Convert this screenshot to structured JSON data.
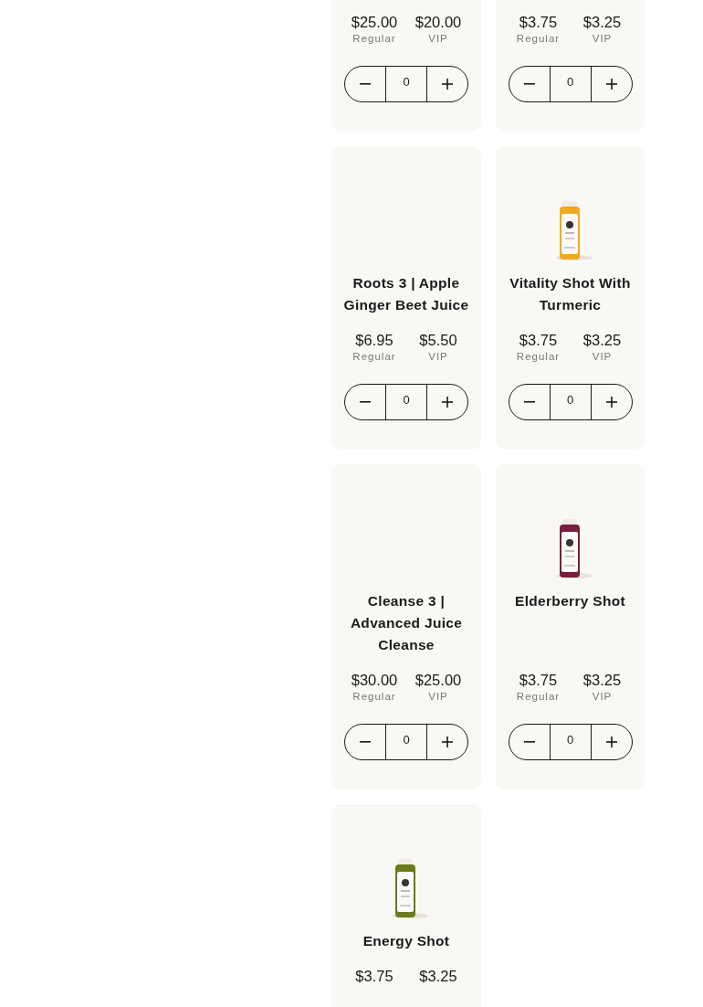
{
  "products": [
    {
      "prices": [
        {
          "amount": "$25.00",
          "label": "Regular"
        },
        {
          "amount": "$20.00",
          "label": "VIP"
        }
      ],
      "quantity": "0"
    },
    {
      "prices": [
        {
          "amount": "$3.75",
          "label": "Regular"
        },
        {
          "amount": "$3.25",
          "label": "VIP"
        }
      ],
      "quantity": "0"
    },
    {
      "name": "Roots 3 | Apple Ginger Beet Juice",
      "prices": [
        {
          "amount": "$6.95",
          "label": "Regular"
        },
        {
          "amount": "$5.50",
          "label": "VIP"
        }
      ],
      "quantity": "0"
    },
    {
      "name": "Vitality Shot With Turmeric",
      "prices": [
        {
          "amount": "$3.75",
          "label": "Regular"
        },
        {
          "amount": "$3.25",
          "label": "VIP"
        }
      ],
      "quantity": "0"
    },
    {
      "name": "Cleanse 3 | Advanced Juice Cleanse",
      "prices": [
        {
          "amount": "$30.00",
          "label": "Regular"
        },
        {
          "amount": "$25.00",
          "label": "VIP"
        }
      ],
      "quantity": "0"
    },
    {
      "name": "Elderberry Shot",
      "prices": [
        {
          "amount": "$3.75",
          "label": "Regular"
        },
        {
          "amount": "$3.25",
          "label": "VIP"
        }
      ],
      "quantity": "0"
    },
    {
      "name": "Energy Shot",
      "prices": [
        {
          "amount": "$3.75"
        },
        {
          "amount": "$3.25"
        }
      ]
    }
  ]
}
